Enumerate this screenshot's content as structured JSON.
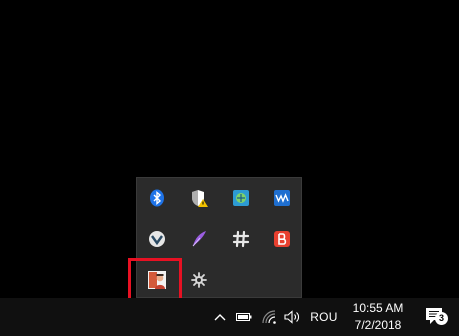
{
  "tray_flyout": {
    "icons": [
      {
        "name": "bluetooth-icon"
      },
      {
        "name": "defender-warning-icon"
      },
      {
        "name": "network-app-icon"
      },
      {
        "name": "waves-audio-icon"
      },
      {
        "name": "vmware-icon"
      },
      {
        "name": "feather-pen-icon"
      },
      {
        "name": "slack-icon"
      },
      {
        "name": "b-app-icon"
      },
      {
        "name": "user-app-icon",
        "highlighted": true
      },
      {
        "name": "settings-gear-icon"
      }
    ]
  },
  "taskbar": {
    "input_indicator": "ROU",
    "clock": {
      "time": "10:55 AM",
      "date": "7/2/2018"
    },
    "notifications_count": "3"
  },
  "colors": {
    "background": "#000000",
    "flyout": "#2b2b2b",
    "taskbar": "#101010",
    "highlight": "#e81123",
    "bluetooth": "#1e73e8"
  }
}
